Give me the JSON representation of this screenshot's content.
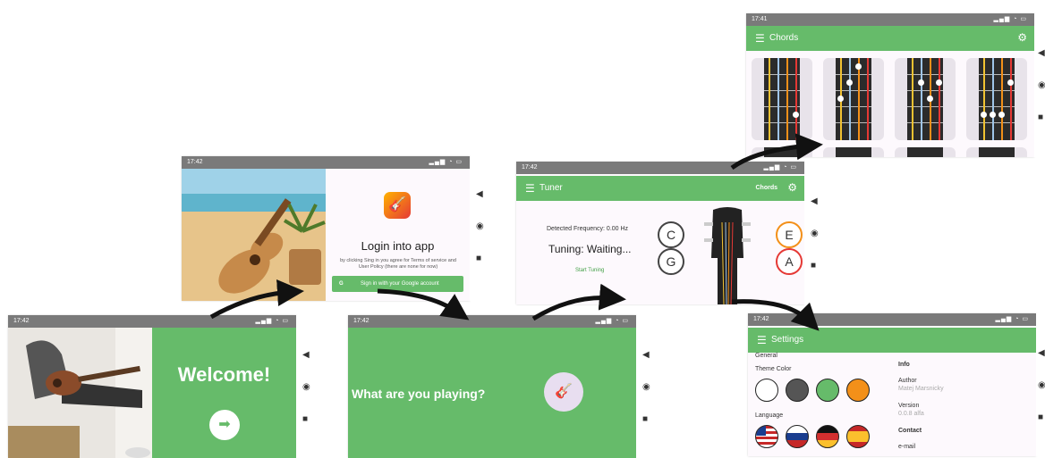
{
  "status": {
    "time_a": "17:42",
    "time_b": "17:41",
    "icons": "▂▄▆ ◔ ▭"
  },
  "welcome": {
    "title": "Welcome!",
    "next_icon": "arrow-right-icon"
  },
  "login": {
    "title": "Login into app",
    "terms": "by clicking Sing in you agree for Terms of service and User Policy (there are none for now)",
    "google_button": "Sign in with your Google account"
  },
  "playing": {
    "question": "What are you playing?"
  },
  "tuner": {
    "title": "Tuner",
    "chords_link": "Chords",
    "detected": "Detected Frequency: 0.00 Hz",
    "tuning_status": "Tuning: Waiting...",
    "start_label": "Start Tuning",
    "notes": {
      "c": "C",
      "g": "G",
      "e": "E",
      "a": "A"
    }
  },
  "chords": {
    "title": "Chords"
  },
  "settings": {
    "title": "Settings",
    "general": "General",
    "theme_color": "Theme Color",
    "language": "Language",
    "info": "Info",
    "author_label": "Author",
    "author_value": "Matej Marsnicky",
    "version_label": "Version",
    "version_value": "0.0.8 alfa",
    "contact": "Contact",
    "email_label": "e-mail",
    "colors": [
      "#ffffff",
      "#555555",
      "#66bb6a",
      "#f39019"
    ]
  }
}
